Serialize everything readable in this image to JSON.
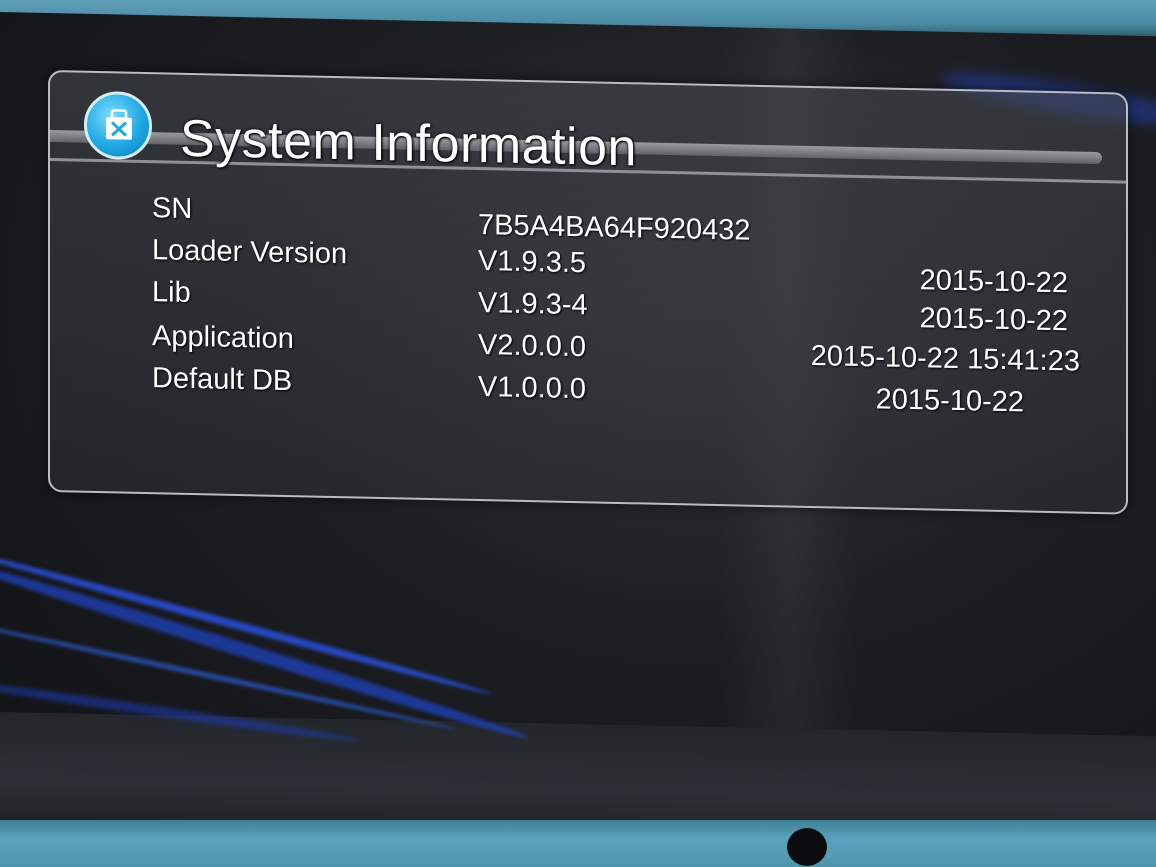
{
  "window": {
    "title": "System Information",
    "icon": "toolbox-icon"
  },
  "info_rows": [
    {
      "label": "SN",
      "version": "7B5A4BA64F920432",
      "date": ""
    },
    {
      "label": "Loader Version",
      "version": "V1.9.3.5",
      "date": "2015-10-22"
    },
    {
      "label": "Lib",
      "version": "V1.9.3-4",
      "date": "2015-10-22"
    },
    {
      "label": "Application",
      "version": "V2.0.0.0",
      "date": "2015-10-22 15:41:23"
    },
    {
      "label": "Default DB",
      "version": "V1.0.0.0",
      "date": "2015-10-22"
    }
  ],
  "colors": {
    "text": "#ffffff",
    "icon_accent": "#1fa9e3",
    "panel_border": "#b9bcc2"
  }
}
